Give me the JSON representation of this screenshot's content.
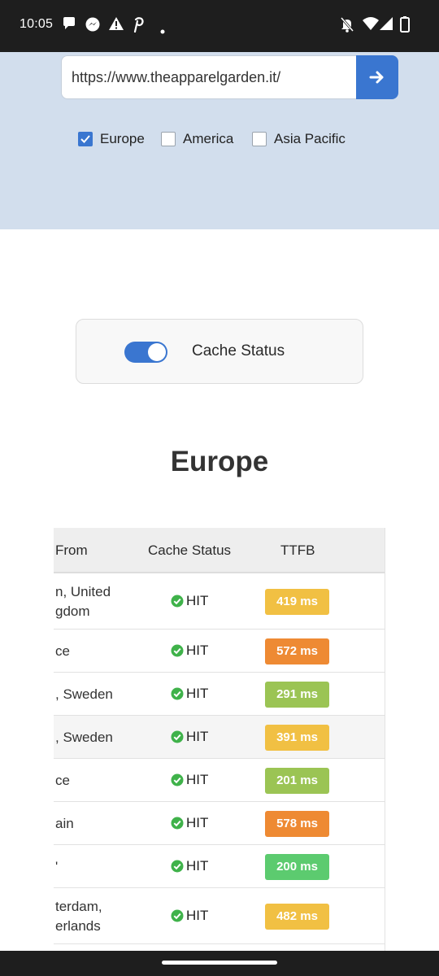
{
  "statusbar": {
    "time": "10:05"
  },
  "search": {
    "url": "https://www.theapparelgarden.it/"
  },
  "regions": [
    {
      "label": "Europe",
      "checked": true
    },
    {
      "label": "America",
      "checked": false
    },
    {
      "label": "Asia Pacific",
      "checked": false
    }
  ],
  "cache_toggle": {
    "label": "Cache Status",
    "on": true
  },
  "section": {
    "title": "Europe"
  },
  "table": {
    "headers": [
      "From",
      "Cache Status",
      "TTFB"
    ],
    "rows": [
      {
        "from_line1": "n, United",
        "from_line2": "gdom",
        "status": "HIT",
        "ttfb": "419 ms",
        "color": "#f1c043"
      },
      {
        "from_line1": "ce",
        "from_line2": "",
        "status": "HIT",
        "ttfb": "572 ms",
        "color": "#ee8a33"
      },
      {
        "from_line1": ", Sweden",
        "from_line2": "",
        "status": "HIT",
        "ttfb": "291 ms",
        "color": "#9bc454"
      },
      {
        "from_line1": ", Sweden",
        "from_line2": "",
        "status": "HIT",
        "ttfb": "391 ms",
        "color": "#f1c043"
      },
      {
        "from_line1": "ce",
        "from_line2": "",
        "status": "HIT",
        "ttfb": "201 ms",
        "color": "#9bc454"
      },
      {
        "from_line1": "ain",
        "from_line2": "",
        "status": "HIT",
        "ttfb": "578 ms",
        "color": "#ee8a33"
      },
      {
        "from_line1": "'",
        "from_line2": "",
        "status": "HIT",
        "ttfb": "200 ms",
        "color": "#5ccb6f"
      },
      {
        "from_line1": "terdam,",
        "from_line2": "erlands",
        "status": "HIT",
        "ttfb": "482 ms",
        "color": "#f1c043"
      }
    ]
  },
  "colors": {
    "accent": "#3a76d0",
    "hit_icon": "#3fb24a",
    "hero_bg": "#d2deed"
  }
}
